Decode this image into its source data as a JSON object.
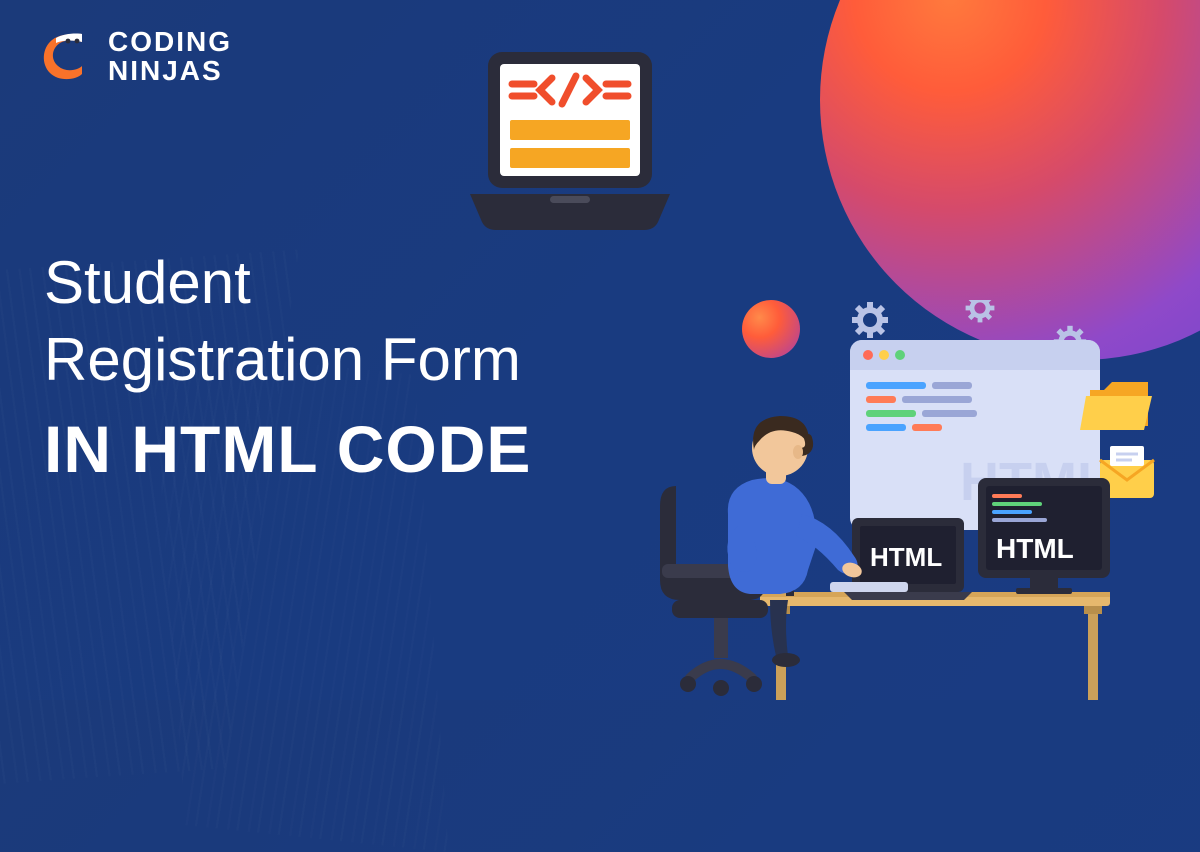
{
  "logo": {
    "line1": "CODING",
    "line2": "NINJAS"
  },
  "headline": {
    "line1": "Student",
    "line2": "Registration Form",
    "line3": "IN HTML CODE"
  },
  "laptop": {
    "code_symbol": "</>",
    "bar_color": "#f6a623",
    "accent_color": "#f04e2c"
  },
  "scene": {
    "browser_text": "HTML",
    "laptop_text": "HTML",
    "monitor_text": "HTML"
  },
  "colors": {
    "bg": "#1a3b82",
    "orange": "#f9722a",
    "red": "#f04e2c",
    "purple": "#8f49c9",
    "yellow": "#f6a623",
    "white": "#ffffff",
    "dark": "#2b2c3a"
  }
}
